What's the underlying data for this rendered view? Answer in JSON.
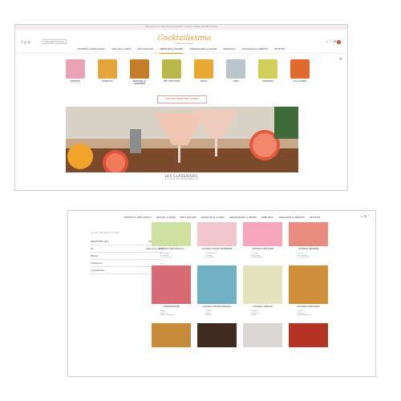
{
  "top": {
    "promo": "Découvrez nos sélections de produits · livraison offerte dès 60€ d'achat",
    "social": "f  ◎  ✉",
    "lang": "Français (France)",
    "logo_name": "Cocktailissima",
    "logo_sub": "Le bar à la maison",
    "icons": "⌕  ♡  ◔",
    "cart_count": "0",
    "nav": [
      "COFFRETS & IDÉE CADEAU",
      "ARTS DE LA TABLE",
      "PETIT ÉLECTRO",
      "SIROPS BIO & SUCRES",
      "ARÔMATISANTS & ZESTES",
      "SPIRITUEUX",
      "CRAQUANTS & APÉRITIFS",
      "RECETTES"
    ],
    "active_nav": "SIROPS BIO & SUCRES",
    "categories": [
      {
        "label": "APÉRITIFS",
        "count": "(53 produits)",
        "color": "#e9a3b4"
      },
      {
        "label": "KOMBUCHA",
        "count": "",
        "color": "#e5a43a"
      },
      {
        "label": "BOISSONS AU GINGEMBRE",
        "count": "",
        "color": "#c47e2a"
      },
      {
        "label": "THÉ & INFUSIONS",
        "count": "",
        "color": "#b9b74a"
      },
      {
        "label": "SODAS",
        "count": "",
        "color": "#e8a932"
      },
      {
        "label": "TONIC",
        "count": "",
        "color": "#b9c4cb"
      },
      {
        "label": "LIMONADES",
        "count": "",
        "color": "#cfcf5a"
      },
      {
        "label": "JUS & PURÉES",
        "count": "",
        "color": "#e06a2e"
      }
    ],
    "all_button": "VOIR TOUT SIROPS BIO & SUCRES",
    "hero_title": "LES CLASSIQUES",
    "hero_subtitle": "Voir toutes les recettes classiques"
  },
  "bottom": {
    "nav": [
      "COFFRETS & IDÉE CADEAU",
      "ARTS DE LA TABLE",
      "PETIT ÉLECTRO",
      "SIROPS BIO & SUCRES",
      "ARÔMATISANTS & ZESTES",
      "SPIRITUEUX",
      "CRAQUANTS & APÉRITIFS",
      "RECETTES"
    ],
    "icons": "⌕  ◔  ♡",
    "breadcrumb": "Accueil / Recettes / Cocktails",
    "filters": [
      {
        "label": "RECETTES (48)",
        "value": "TRIER PAR ▾"
      },
      {
        "label": "Tri",
        "value": "Sélectionner ▾"
      },
      {
        "label": "Filtres",
        "value": ""
      },
      {
        "label": "Catégorie",
        "value": "+"
      },
      {
        "label": "Ingrédients",
        "value": "+"
      }
    ],
    "cards": [
      {
        "title": "COCKTAIL FIZZ TEQUILA",
        "ingredients": "• 4 cl tequila\n• 3 cl citron\n• 2 cl sirop miel",
        "color": "#cfe0a0"
      },
      {
        "title": "COCKTAIL MOJITO FRAMBOISE",
        "ingredients": "• framboises\n• menthe\n• 4 cl rhum",
        "color": "#f2c6cf"
      },
      {
        "title": "COCKTAIL FIZZ ROSE",
        "ingredients": "• 4 cl gin\n• sirop rose\n• eau pétillante",
        "color": "#f5a6be"
      },
      {
        "title": "COCKTAIL NEGRONI",
        "ingredients": "• 3 cl gin\n• 3 cl campari\n• 3 cl vermouth",
        "color": "#e98c80"
      },
      {
        "title": "COSMOPOLITAN",
        "ingredients": "• vodka\n• triple sec\n• jus de cranberry",
        "color": "#d66b74"
      },
      {
        "title": "COCKTAIL FRAISE & BASILIC",
        "ingredients": "• fraises\n• basilic\n• 4 cl gin",
        "color": "#6fb0c3"
      },
      {
        "title": "COCKTAIL SIDECAR",
        "ingredients": "• cognac\n• triple sec\n• citron",
        "color": "#e5e2bf"
      },
      {
        "title": "COCKTAIL MARGARITA",
        "ingredients": "• tequila\n• triple sec\n• jus de citron vert",
        "color": "#d18e3b"
      },
      {
        "title": "",
        "ingredients": "",
        "color": "#c58b3a"
      },
      {
        "title": "",
        "ingredients": "",
        "color": "#3e2a1e"
      },
      {
        "title": "",
        "ingredients": "",
        "color": "#d9d6d3"
      },
      {
        "title": "",
        "ingredients": "",
        "color": "#b33322"
      }
    ]
  }
}
